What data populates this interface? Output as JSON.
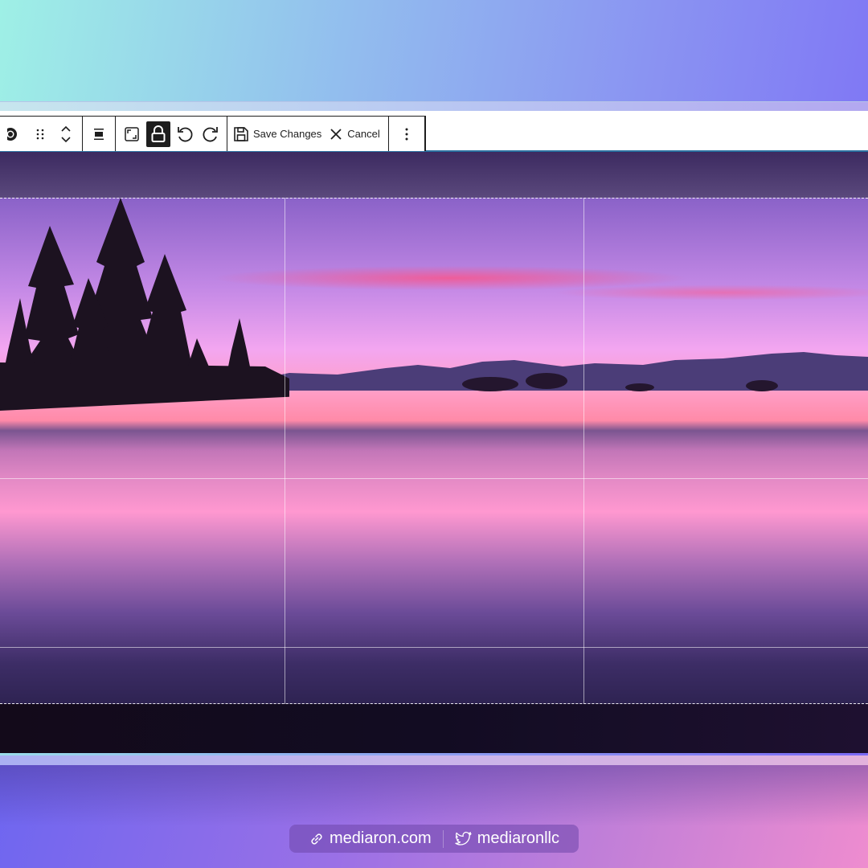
{
  "toolbar": {
    "save_label": "Save Changes",
    "cancel_label": "Cancel",
    "icons": [
      "aperture-icon",
      "drag-handle-icon",
      "move-up-down-icon",
      "align-icon",
      "aspect-ratio-icon",
      "lock-icon",
      "rotate-left-icon",
      "rotate-right-icon",
      "save-icon",
      "close-icon",
      "more-options-icon"
    ],
    "lock_active": true
  },
  "image": {
    "description": "Lake sunset with pine tree silhouettes, pink and purple sky",
    "grid": "rule-of-thirds"
  },
  "footer": {
    "website": "mediaron.com",
    "twitter": "mediaronllc"
  },
  "colors": {
    "toolbar_border": "#1e1e1e",
    "active_button": "#1e1e1e",
    "editor_accent": "#2a6fa0"
  }
}
